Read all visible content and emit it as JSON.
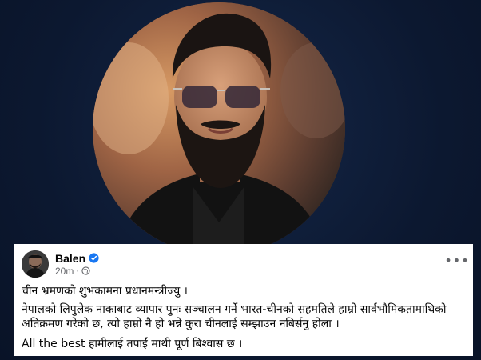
{
  "post": {
    "author": "Balen",
    "time": "20m",
    "paragraph1": "चीन भ्रमणको शुभकामना प्रधानमन्त्रीज्यु ।",
    "paragraph2": "नेपालको लिपुलेक नाकाबाट व्यापार पुनः सञ्चालन गर्ने भारत-चीनको सहमतिले हाम्रो सार्वभौमिकतामाथिको अतिक्रमण गरेको छ, त्यो हाम्रो नै हो भन्ने कुरा चीनलाई सम्झाउन नबिर्सनु होला ।",
    "paragraph3": "All the best हामीलाई तपाईं माथी पूर्ण बिश्वास छ ।",
    "more_label": "•••"
  },
  "icons": {
    "verified": "verified-badge-icon",
    "privacy": "globe-icon",
    "more": "more-options-icon"
  },
  "colors": {
    "background": "#0d1a33",
    "verified": "#1877f2",
    "text": "#050505",
    "muted": "#65676b"
  }
}
